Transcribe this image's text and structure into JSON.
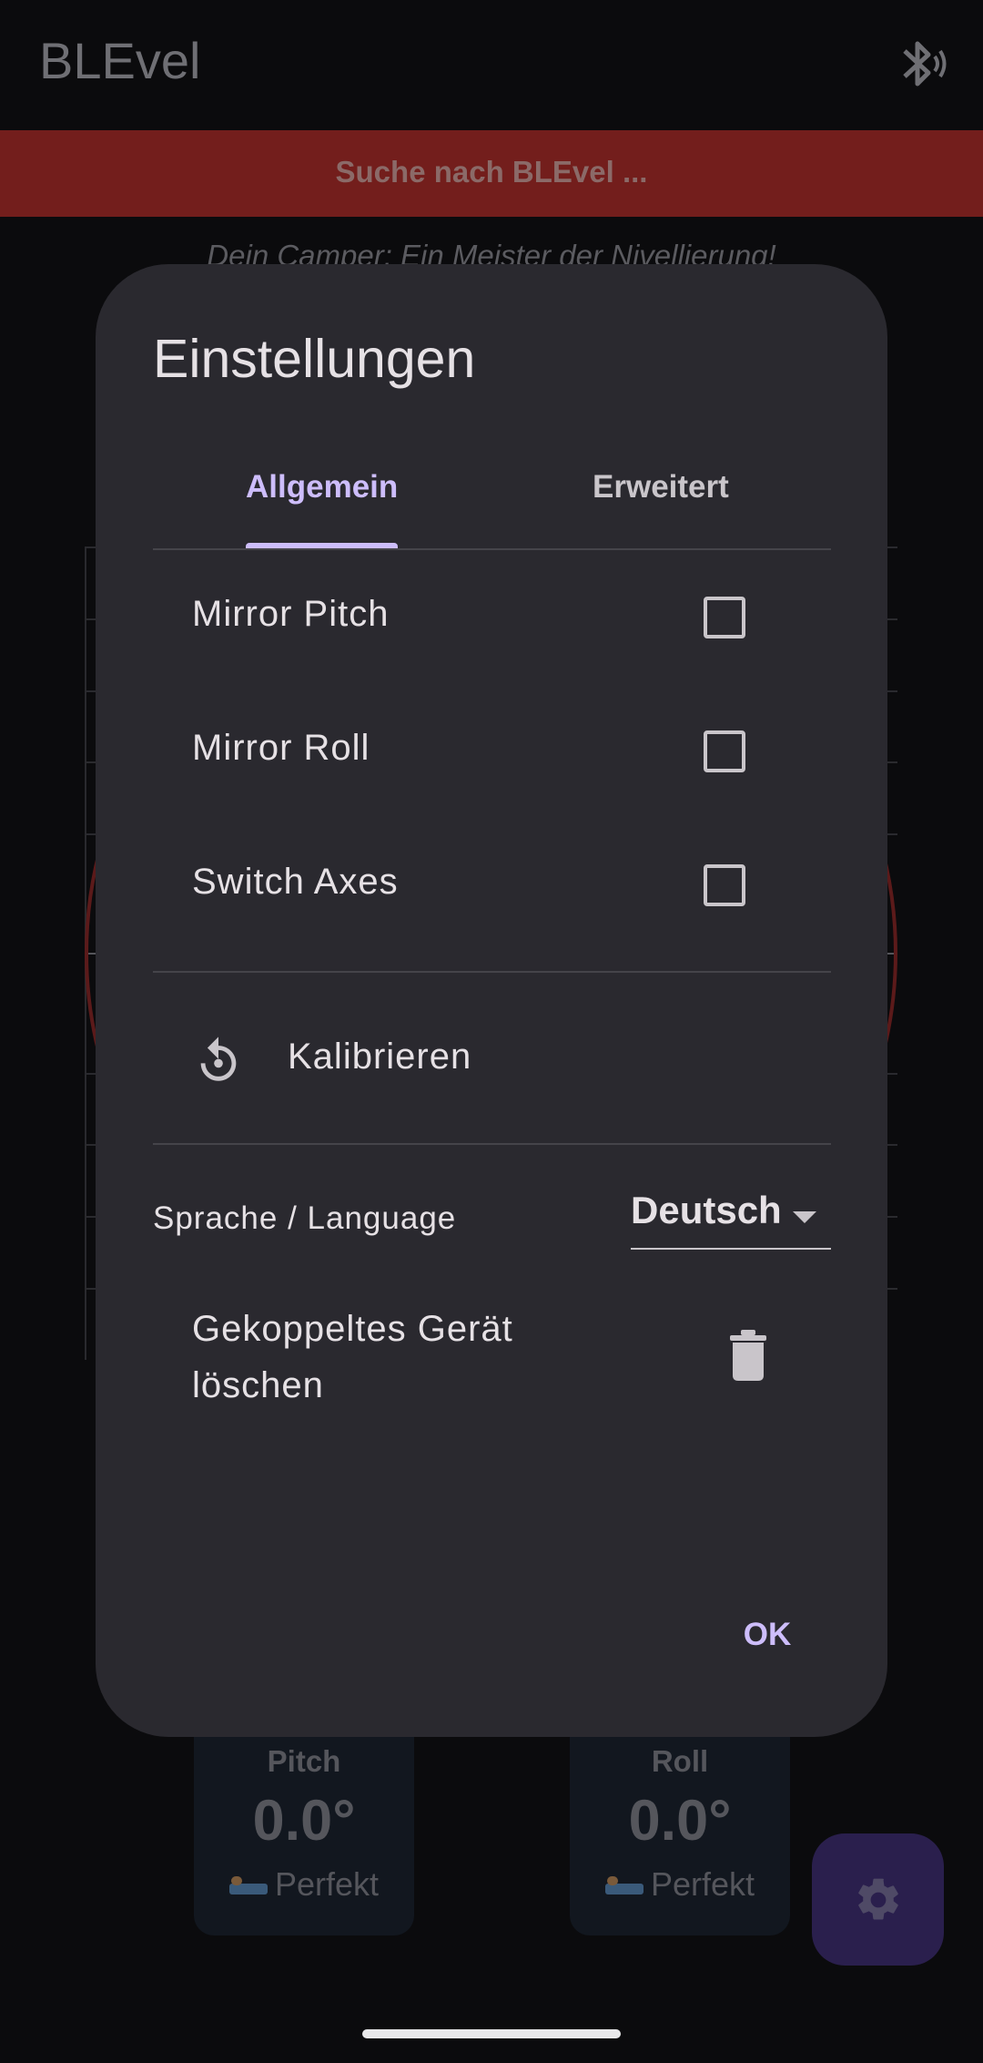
{
  "app": {
    "title": "BLEvel",
    "bluetooth_icon": "bluetooth-searching-icon",
    "banner_text": "Suche nach BLEvel ...",
    "banner_color": "#731e1c",
    "subtitle": "Dein Camper: Ein Meister der Nivellierung!"
  },
  "stats": {
    "pitch": {
      "label": "Pitch",
      "value": "0.0°",
      "status": "Perfekt",
      "status_icon": "bed-icon"
    },
    "roll": {
      "label": "Roll",
      "value": "0.0°",
      "status": "Perfekt",
      "status_icon": "bed-icon"
    }
  },
  "fab": {
    "icon": "gear-icon"
  },
  "dialog": {
    "title": "Einstellungen",
    "tabs": [
      {
        "label": "Allgemein",
        "active": true
      },
      {
        "label": "Erweitert",
        "active": false
      }
    ],
    "options": [
      {
        "label": "Mirror Pitch",
        "checked": false
      },
      {
        "label": "Mirror Roll",
        "checked": false
      },
      {
        "label": "Switch Axes",
        "checked": false
      }
    ],
    "calibrate": {
      "label": "Kalibrieren",
      "icon": "restart-icon"
    },
    "language": {
      "label": "Sprache / Language",
      "value": "Deutsch",
      "icon": "dropdown-arrow-icon"
    },
    "delete_device": {
      "label": "Gekoppeltes Gerät löschen",
      "icon": "trash-icon"
    },
    "ok_label": "OK",
    "accent_color": "#cdbdfb"
  }
}
